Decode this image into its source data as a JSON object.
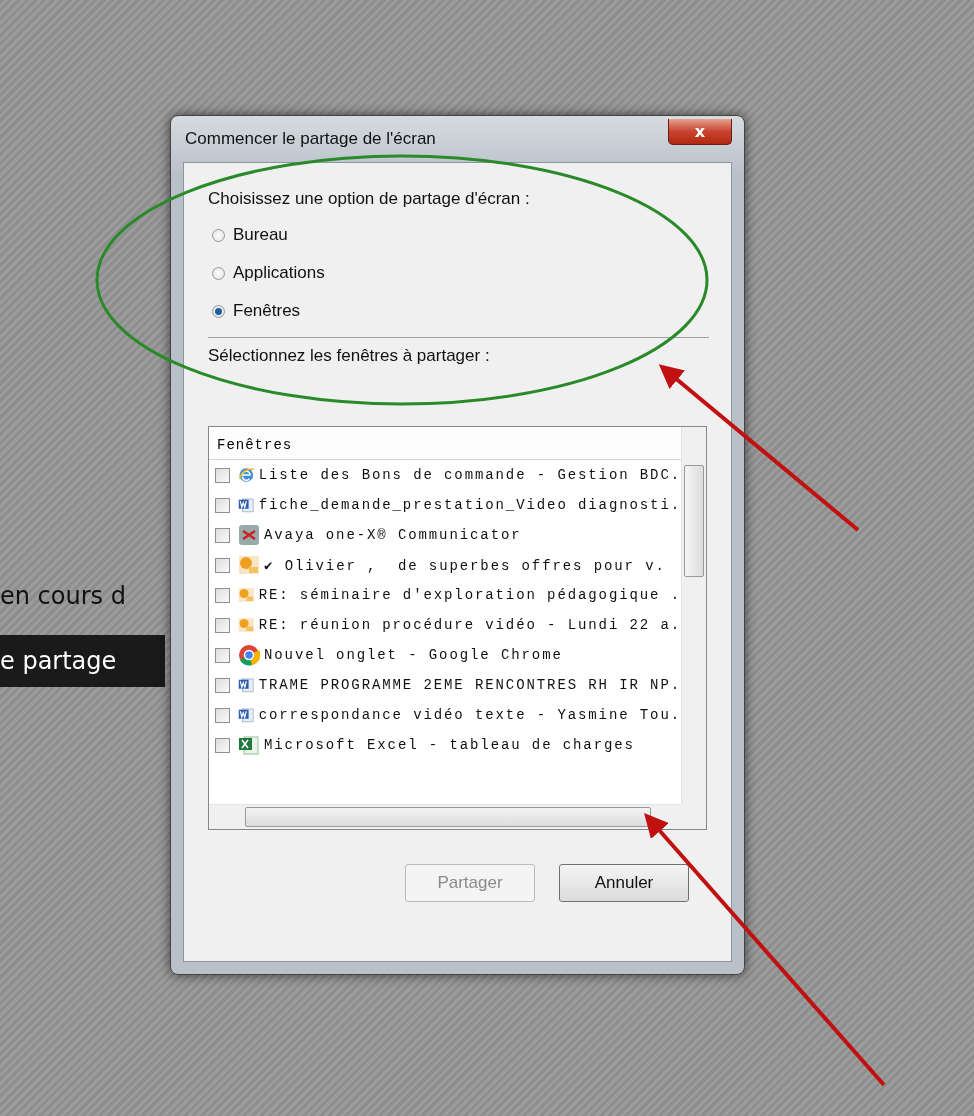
{
  "background": {
    "texts": [
      "en cours d"
    ],
    "bar_text": "e partage"
  },
  "dialog": {
    "title": "Commencer le partage de l'écran",
    "close": "x",
    "option_label": "Choisissez une option de partage d'écran :",
    "options": [
      {
        "label": "Bureau",
        "selected": false
      },
      {
        "label": "Applications",
        "selected": false
      },
      {
        "label": "Fenêtres",
        "selected": true
      }
    ],
    "list_label": "Sélectionnez les fenêtres à partager :",
    "list": {
      "header": "Fenêtres",
      "rows": [
        {
          "kind": "ie",
          "label": "Liste des Bons de commande - Gestion BDC.",
          "checked": false
        },
        {
          "kind": "word",
          "label": "fiche_demande_prestation_Video diagnosti.",
          "checked": false
        },
        {
          "kind": "avaya",
          "label": "Avaya one-X® Communicator",
          "checked": false
        },
        {
          "kind": "outlook",
          "label": "✔ Olivier ,  de superbes offres pour v.",
          "checked": false
        },
        {
          "kind": "outlook",
          "label": "RE: séminaire d'exploration pédagogique .",
          "checked": false
        },
        {
          "kind": "outlook",
          "label": "RE: réunion procédure vidéo - Lundi 22 a.",
          "checked": false
        },
        {
          "kind": "chrome",
          "label": "Nouvel onglet - Google Chrome",
          "checked": false
        },
        {
          "kind": "word",
          "label": "TRAME PROGRAMME 2EME RENCONTRES RH IR NP.",
          "checked": false
        },
        {
          "kind": "word",
          "label": "correspondance vidéo texte - Yasmine Tou.",
          "checked": false
        },
        {
          "kind": "excel",
          "label": "Microsoft Excel - tableau de charges",
          "checked": false
        }
      ]
    },
    "buttons": [
      {
        "label": "Partager",
        "disabled": true
      },
      {
        "label": "Annuler",
        "disabled": false
      }
    ]
  }
}
